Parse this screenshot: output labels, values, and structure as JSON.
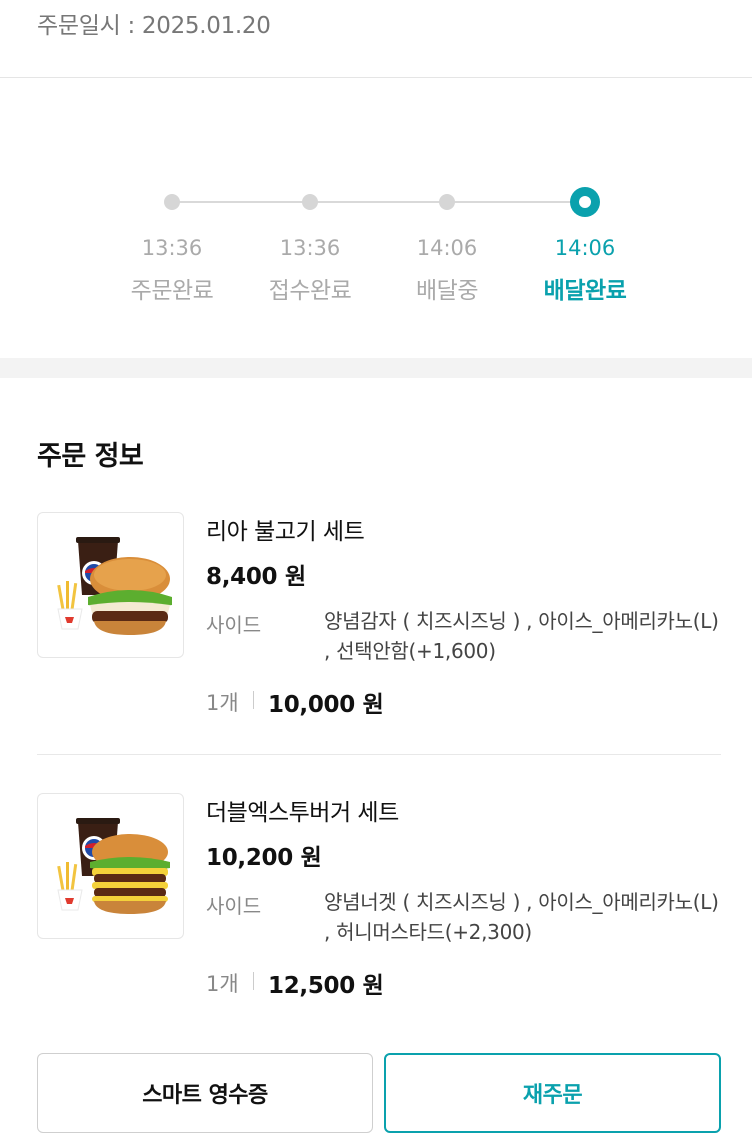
{
  "order_date": "주문일시 : 2025.01.20",
  "status_steps": [
    {
      "time": "13:36",
      "label": "주문완료"
    },
    {
      "time": "13:36",
      "label": "접수완료"
    },
    {
      "time": "14:06",
      "label": "배달중"
    },
    {
      "time": "14:06",
      "label": "배달완료"
    }
  ],
  "active_step_index": 3,
  "colors": {
    "accent": "#0aa1ad",
    "inactive": "#aaaaaa"
  },
  "order_info": {
    "title": "주문 정보",
    "items": [
      {
        "name": "리아 불고기 세트",
        "price": "8,400 원",
        "option_key": "사이드",
        "option_line1": "양념감자 ( 치즈시즈닝 ) , 아이스_아메리카노(L)",
        "option_line2": ", 선택안함(+1,600)",
        "quantity": "1개",
        "total": "10,000 원",
        "image_icon": "bulgogi-burger-set-image"
      },
      {
        "name": "더블엑스투버거 세트",
        "price": "10,200 원",
        "option_key": "사이드",
        "option_line1": "양념너겟 ( 치즈시즈닝 ) , 아이스_아메리카노(L)",
        "option_line2": ", 허니머스타드(+2,300)",
        "quantity": "1개",
        "total": "12,500 원",
        "image_icon": "double-x2-burger-set-image"
      }
    ]
  },
  "buttons": {
    "receipt": "스마트 영수증",
    "reorder": "재주문"
  }
}
